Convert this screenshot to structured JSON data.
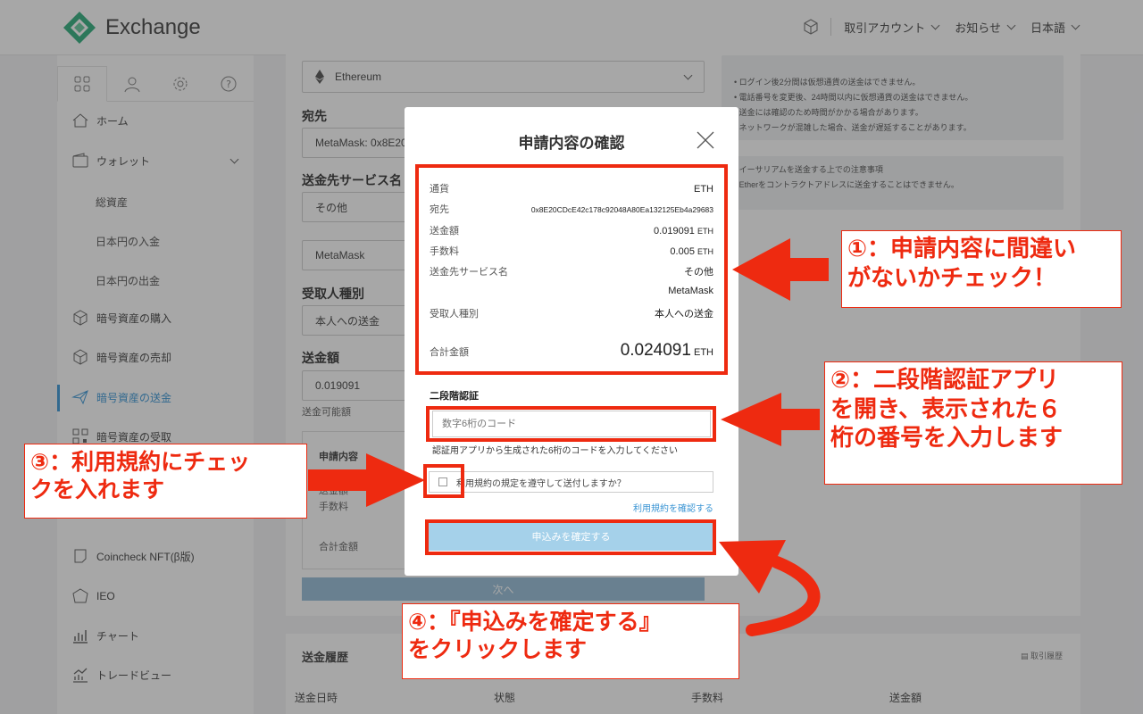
{
  "header": {
    "brand": "Exchange",
    "account_menu": "取引アカウント",
    "news_menu": "お知らせ",
    "language_menu": "日本語"
  },
  "sidebar": {
    "items": [
      {
        "label": "ホーム"
      },
      {
        "label": "ウォレット"
      },
      {
        "label": "総資産"
      },
      {
        "label": "日本円の入金"
      },
      {
        "label": "日本円の出金"
      },
      {
        "label": "暗号資産の購入"
      },
      {
        "label": "暗号資産の売却"
      },
      {
        "label": "暗号資産の送金"
      },
      {
        "label": "暗号資産の受取"
      },
      {
        "label": "Coincheck NFT(β版)"
      },
      {
        "label": "IEO"
      },
      {
        "label": "チャート"
      },
      {
        "label": "トレードビュー"
      }
    ]
  },
  "form": {
    "currency": "Ethereum",
    "address_label": "宛先",
    "address_value": "MetaMask: 0x8E20C",
    "service_label": "送金先サービス名",
    "service_value": "その他",
    "service_detail": "MetaMask",
    "recipient_label": "受取人種別",
    "recipient_value": "本人への送金",
    "amount_label": "送金額",
    "amount_value": "0.019091",
    "available_label": "送金可能額",
    "summary_title": "申請内容",
    "summary_amount": "送金額",
    "summary_fee": "手数料",
    "summary_total": "合計金額",
    "next_button": "次へ"
  },
  "notes": {
    "box1": [
      "ログイン後2分間は仮想通貨の送金はできません。",
      "電話番号を変更後、24時間以内に仮想通貨の送金はできません。",
      "送金には確認のため時間がかかる場合があります。",
      "ネットワークが混雑した場合、送金が遅延することがあります。"
    ],
    "box2": [
      "イーサリアムを送金する上での注意事項",
      "Etherをコントラクトアドレスに送金することはできません。"
    ]
  },
  "history": {
    "title": "送金履歴",
    "link": "取引履歴",
    "columns": [
      "送金日時",
      "状態",
      "手数料",
      "送金額"
    ]
  },
  "modal": {
    "title": "申請内容の確認",
    "rows": {
      "currency_label": "通貨",
      "currency_value": "ETH",
      "address_label": "宛先",
      "address_value": "0x8E20CDcE42c178c92048A80Ea132125Eb4a29683",
      "amount_label": "送金額",
      "amount_value": "0.019091",
      "fee_label": "手数料",
      "fee_value": "0.005",
      "unit": "ETH",
      "service_label": "送金先サービス名",
      "service_value": "その他",
      "service_detail": "MetaMask",
      "recipient_label": "受取人種別",
      "recipient_value": "本人への送金",
      "total_label": "合計金額",
      "total_value": "0.024091"
    },
    "twofa_title": "二段階認証",
    "code_placeholder": "数字6桁のコード",
    "code_hint": "認証用アプリから生成された6桁のコードを入力してください",
    "agree_text": "利用規約の規定を遵守して送付しますか？",
    "terms_link": "利用規約を確認する",
    "confirm_button": "申込みを確定する"
  },
  "annotations": {
    "step1": "①：申請内容に間違い\nがないかチェック！",
    "step2": "②：二段階認証アプリ\nを開き、表示された６\n桁の番号を入力します",
    "step3": "③：利用規約にチェッ\nクを入れます",
    "step4": "④：『申込みを確定する』\nをクリックします"
  },
  "colors": {
    "annotation_red": "#ee2a10",
    "brand_green": "#1fa874",
    "confirm_button": "#a5d1ea",
    "link_blue": "#3b95d4"
  }
}
